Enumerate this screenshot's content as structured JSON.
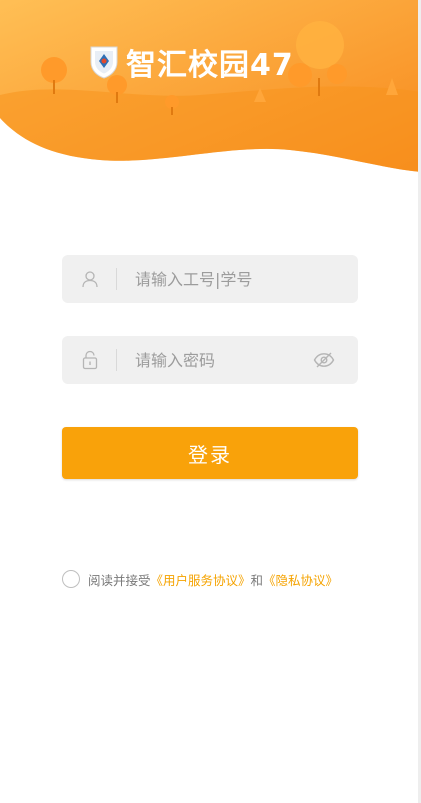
{
  "brand": {
    "name": "智汇校园47"
  },
  "login_form": {
    "username": {
      "placeholder": "请输入工号|学号",
      "icon": "user-icon"
    },
    "password": {
      "placeholder": "请输入密码",
      "icon": "lock-icon",
      "toggle_icon": "eye-hidden-icon"
    },
    "submit_label": "登录"
  },
  "agreement": {
    "checked": false,
    "prefix": "阅读并接受",
    "user_agreement": "《用户服务协议》",
    "connector": "和",
    "privacy_policy": "《隐私协议》"
  },
  "colors": {
    "accent": "#f9a20a",
    "hero_gradient_start": "#ffb347",
    "hero_gradient_end": "#f68a1e",
    "link": "#f5a300"
  }
}
